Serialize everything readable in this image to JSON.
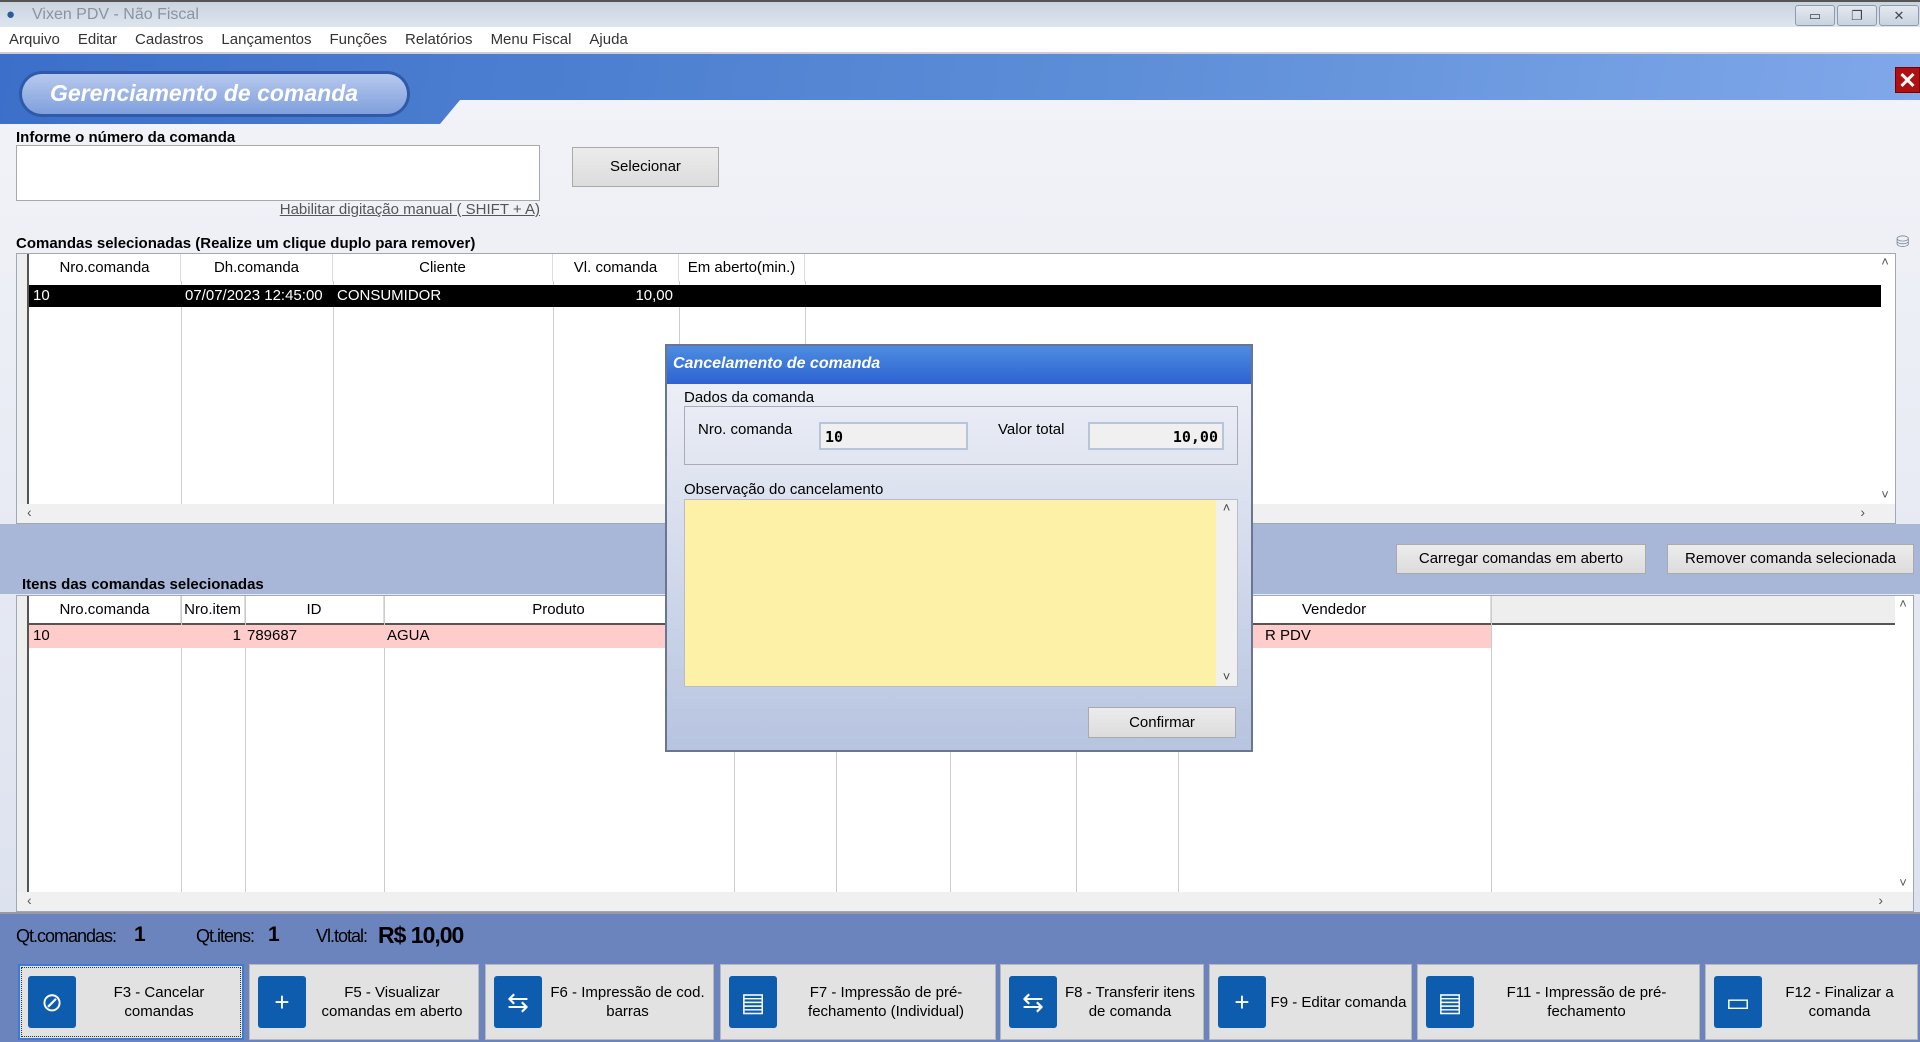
{
  "window": {
    "title": "Vixen PDV - Não Fiscal",
    "minimize": "▭",
    "restore": "❐",
    "close": "✕"
  },
  "menu": [
    "Arquivo",
    "Editar",
    "Cadastros",
    "Lançamentos",
    "Funções",
    "Relatórios",
    "Menu Fiscal",
    "Ajuda"
  ],
  "page": {
    "title": "Gerenciamento de comanda",
    "close": "✕"
  },
  "search": {
    "label": "Informe o número da comanda",
    "value": "",
    "select_button": "Selecionar",
    "manual_link": "Habilitar digitação manual ( SHIFT + A)"
  },
  "comandas": {
    "title": "Comandas selecionadas (Realize um clique duplo para remover)",
    "columns": [
      "Nro.comanda",
      "Dh.comanda",
      "Cliente",
      "Vl. comanda",
      "Em aberto(min.)"
    ],
    "rows": [
      {
        "nro": "10",
        "dh": "07/07/2023 12:45:00",
        "cliente": "CONSUMIDOR",
        "valor": "10,00",
        "aberto": ""
      }
    ]
  },
  "actions": {
    "load_open": "Carregar comandas em aberto",
    "remove_selected": "Remover comanda selecionada"
  },
  "itens": {
    "title": "Itens das comandas selecionadas",
    "columns": [
      "Nro.comanda",
      "Nro.item",
      "ID",
      "Produto",
      "Vendedor"
    ],
    "rows": [
      {
        "nro": "10",
        "item": "1",
        "id": "789687",
        "produto": "AGUA",
        "vendedor": "R PDV"
      }
    ]
  },
  "summary": {
    "qt_comandas_label": "Qt.comandas:",
    "qt_comandas": "1",
    "qt_itens_label": "Qt.itens:",
    "qt_itens": "1",
    "vl_total_label": "Vl.total:",
    "vl_total": "R$ 10,00"
  },
  "fkeys": [
    {
      "label": "F3 - Cancelar comandas",
      "icon": "⊘"
    },
    {
      "label": "F5 - Visualizar comandas em aberto",
      "icon": "+"
    },
    {
      "label": "F6 - Impressão de cod. barras",
      "icon": "⇆"
    },
    {
      "label": "F7 - Impressão de pré-fechamento (Individual)",
      "icon": "▤"
    },
    {
      "label": "F8 - Transferir itens de comanda",
      "icon": "⇆"
    },
    {
      "label": "F9 - Editar comanda",
      "icon": "+"
    },
    {
      "label": "F11 - Impressão de pré-fechamento",
      "icon": "▤"
    },
    {
      "label": "F12 - Finalizar a comanda",
      "icon": "▭"
    }
  ],
  "dialog": {
    "title": "Cancelamento de comanda",
    "group": "Dados da comanda",
    "nro_label": "Nro. comanda",
    "nro_value": "10",
    "valor_label": "Valor total",
    "valor_value": "10,00",
    "obs_label": "Observação do cancelamento",
    "obs_value": "",
    "confirm": "Confirmar"
  },
  "colors": {
    "accent": "#2d62d3",
    "selected_row": "#000000",
    "item_row": "#ffcccc",
    "textarea": "#fdf1a8"
  }
}
